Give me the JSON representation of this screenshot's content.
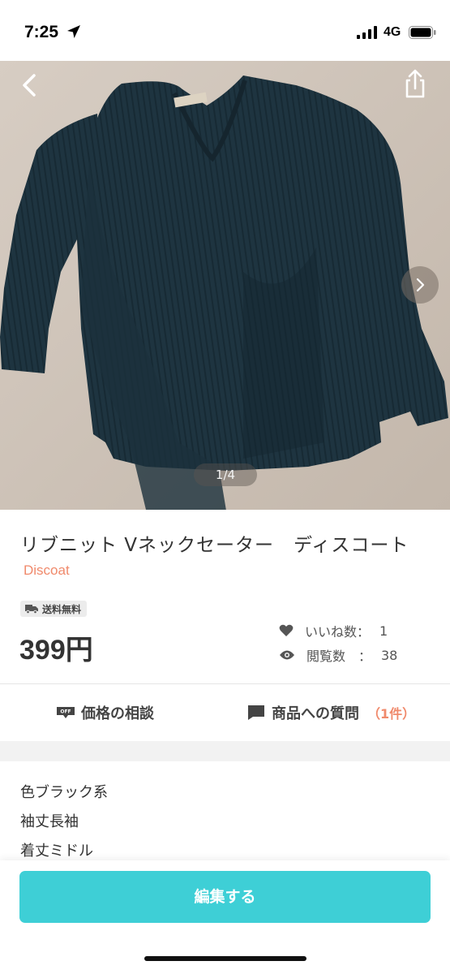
{
  "status_bar": {
    "time": "7:25",
    "network": "4G"
  },
  "photo": {
    "page_indicator": "1/4",
    "icons": [
      "back-chevron-icon",
      "share-icon",
      "chevron-right-icon"
    ]
  },
  "item": {
    "title": "リブニット Vネックセーター　ディスコート",
    "brand": "Discoat",
    "shipping_badge": "送料無料",
    "price": "399円",
    "likes_label": "いいね数：",
    "likes_value": "1",
    "views_label": "閲覧数　：",
    "views_value": "38"
  },
  "actions": {
    "negotiate_label": "価格の相談",
    "question_label": "商品への質問",
    "question_count": "（1件）"
  },
  "specs": [
    {
      "text": "色ブラック系"
    },
    {
      "text": "袖丈長袖"
    },
    {
      "text": "着丈ミドル"
    }
  ],
  "bottom": {
    "edit_label": "編集する"
  },
  "colors": {
    "accent": "#3ecfd6",
    "brand_text": "#f08a6c",
    "sweater": "#1f3540"
  }
}
